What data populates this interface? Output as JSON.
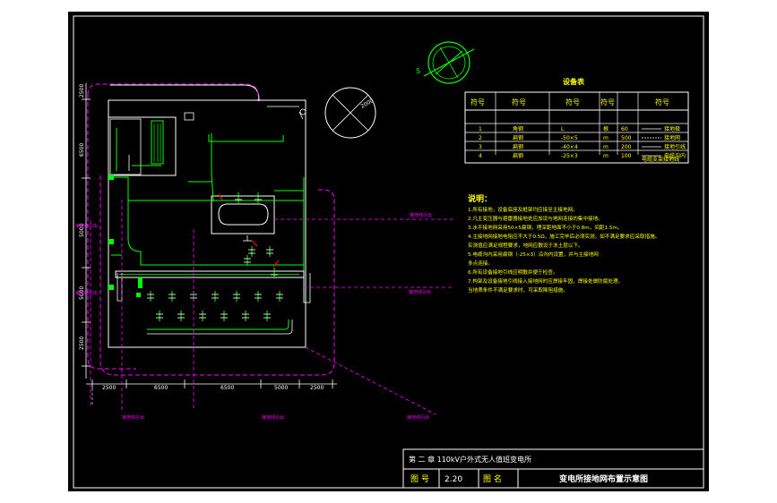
{
  "colors": {
    "background": "#000000",
    "frame": "#ffffff",
    "grounding": "#00ff00",
    "equipment": "#ffffff",
    "notes": "#ffff00",
    "dimension": "#ff00ff",
    "accent_red": "#ff0000"
  },
  "compass": {
    "label": "S"
  },
  "site_circle": {
    "label": "2000"
  },
  "table": {
    "title": "设备表",
    "headers": [
      "符号",
      "符号",
      "符号",
      "符号",
      "符号"
    ],
    "rows": [
      {
        "no": "1",
        "name": "角钢",
        "spec": "L",
        "unit": "根",
        "qty": "60",
        "legend": "接地极"
      },
      {
        "no": "2",
        "name": "扁钢",
        "spec": "-50×5",
        "unit": "m",
        "qty": "500",
        "legend": "接地网"
      },
      {
        "no": "3",
        "name": "扁钢",
        "spec": "-40×4",
        "unit": "m",
        "qty": "200",
        "legend": "接地引线"
      },
      {
        "no": "4",
        "name": "扁钢",
        "spec": "-25×3",
        "unit": "m",
        "qty": "100",
        "legend": "电缆沟内"
      }
    ],
    "footer": "电缆支架接地线"
  },
  "notes": {
    "title": "说明：",
    "lines": [
      "1.所有接地，设备底座及框架均应接至主接地网。",
      "2.凡主变压器与避雷器接地处应加设与地网连接的集中接地。",
      "3.水平接地网采用50×5扁钢，埋深距地面不小于0.8m，间距1.5m。",
      "4.主接地网接地电阻应不大于0.5Ω，施工完毕后必须实测，如不满足要求应采取措施。",
      "   实测值应满足规程要求，地网应敷设于冻土层以下。",
      "5.电缆沟内采用扁钢（-25×3）沿沟内设置，并与主接地网",
      "   多点连接。",
      "6.所有设备接地引线应明敷并便于检查。",
      "7.构架及设备接地引线接入接地网时应焊接牢固，焊接处做防腐处理。",
      "   当地质条件不满足要求时，可采取降阻措施。"
    ]
  },
  "labels": {
    "left_top": "接地线引出",
    "left_mid": "接地线引出",
    "right_top": "接地线引出",
    "right_mid": "接地线引出",
    "bottom_1": "接地线引出",
    "bottom_2": "接地线引出",
    "bottom_3": "接地线引出"
  },
  "dims": {
    "left": [
      "2500",
      "6500",
      "5000",
      "5000",
      "2500"
    ],
    "bottom": [
      "2500",
      "6500",
      "6500",
      "5000",
      "2500"
    ]
  },
  "title_block": {
    "chapter": "第 二 章  110kV户外式无人值班变电所",
    "fig_label": "图 号",
    "fig_no": "2.20",
    "name_label": "图 名",
    "drawing_name": "变电所接地网布置示意图"
  }
}
